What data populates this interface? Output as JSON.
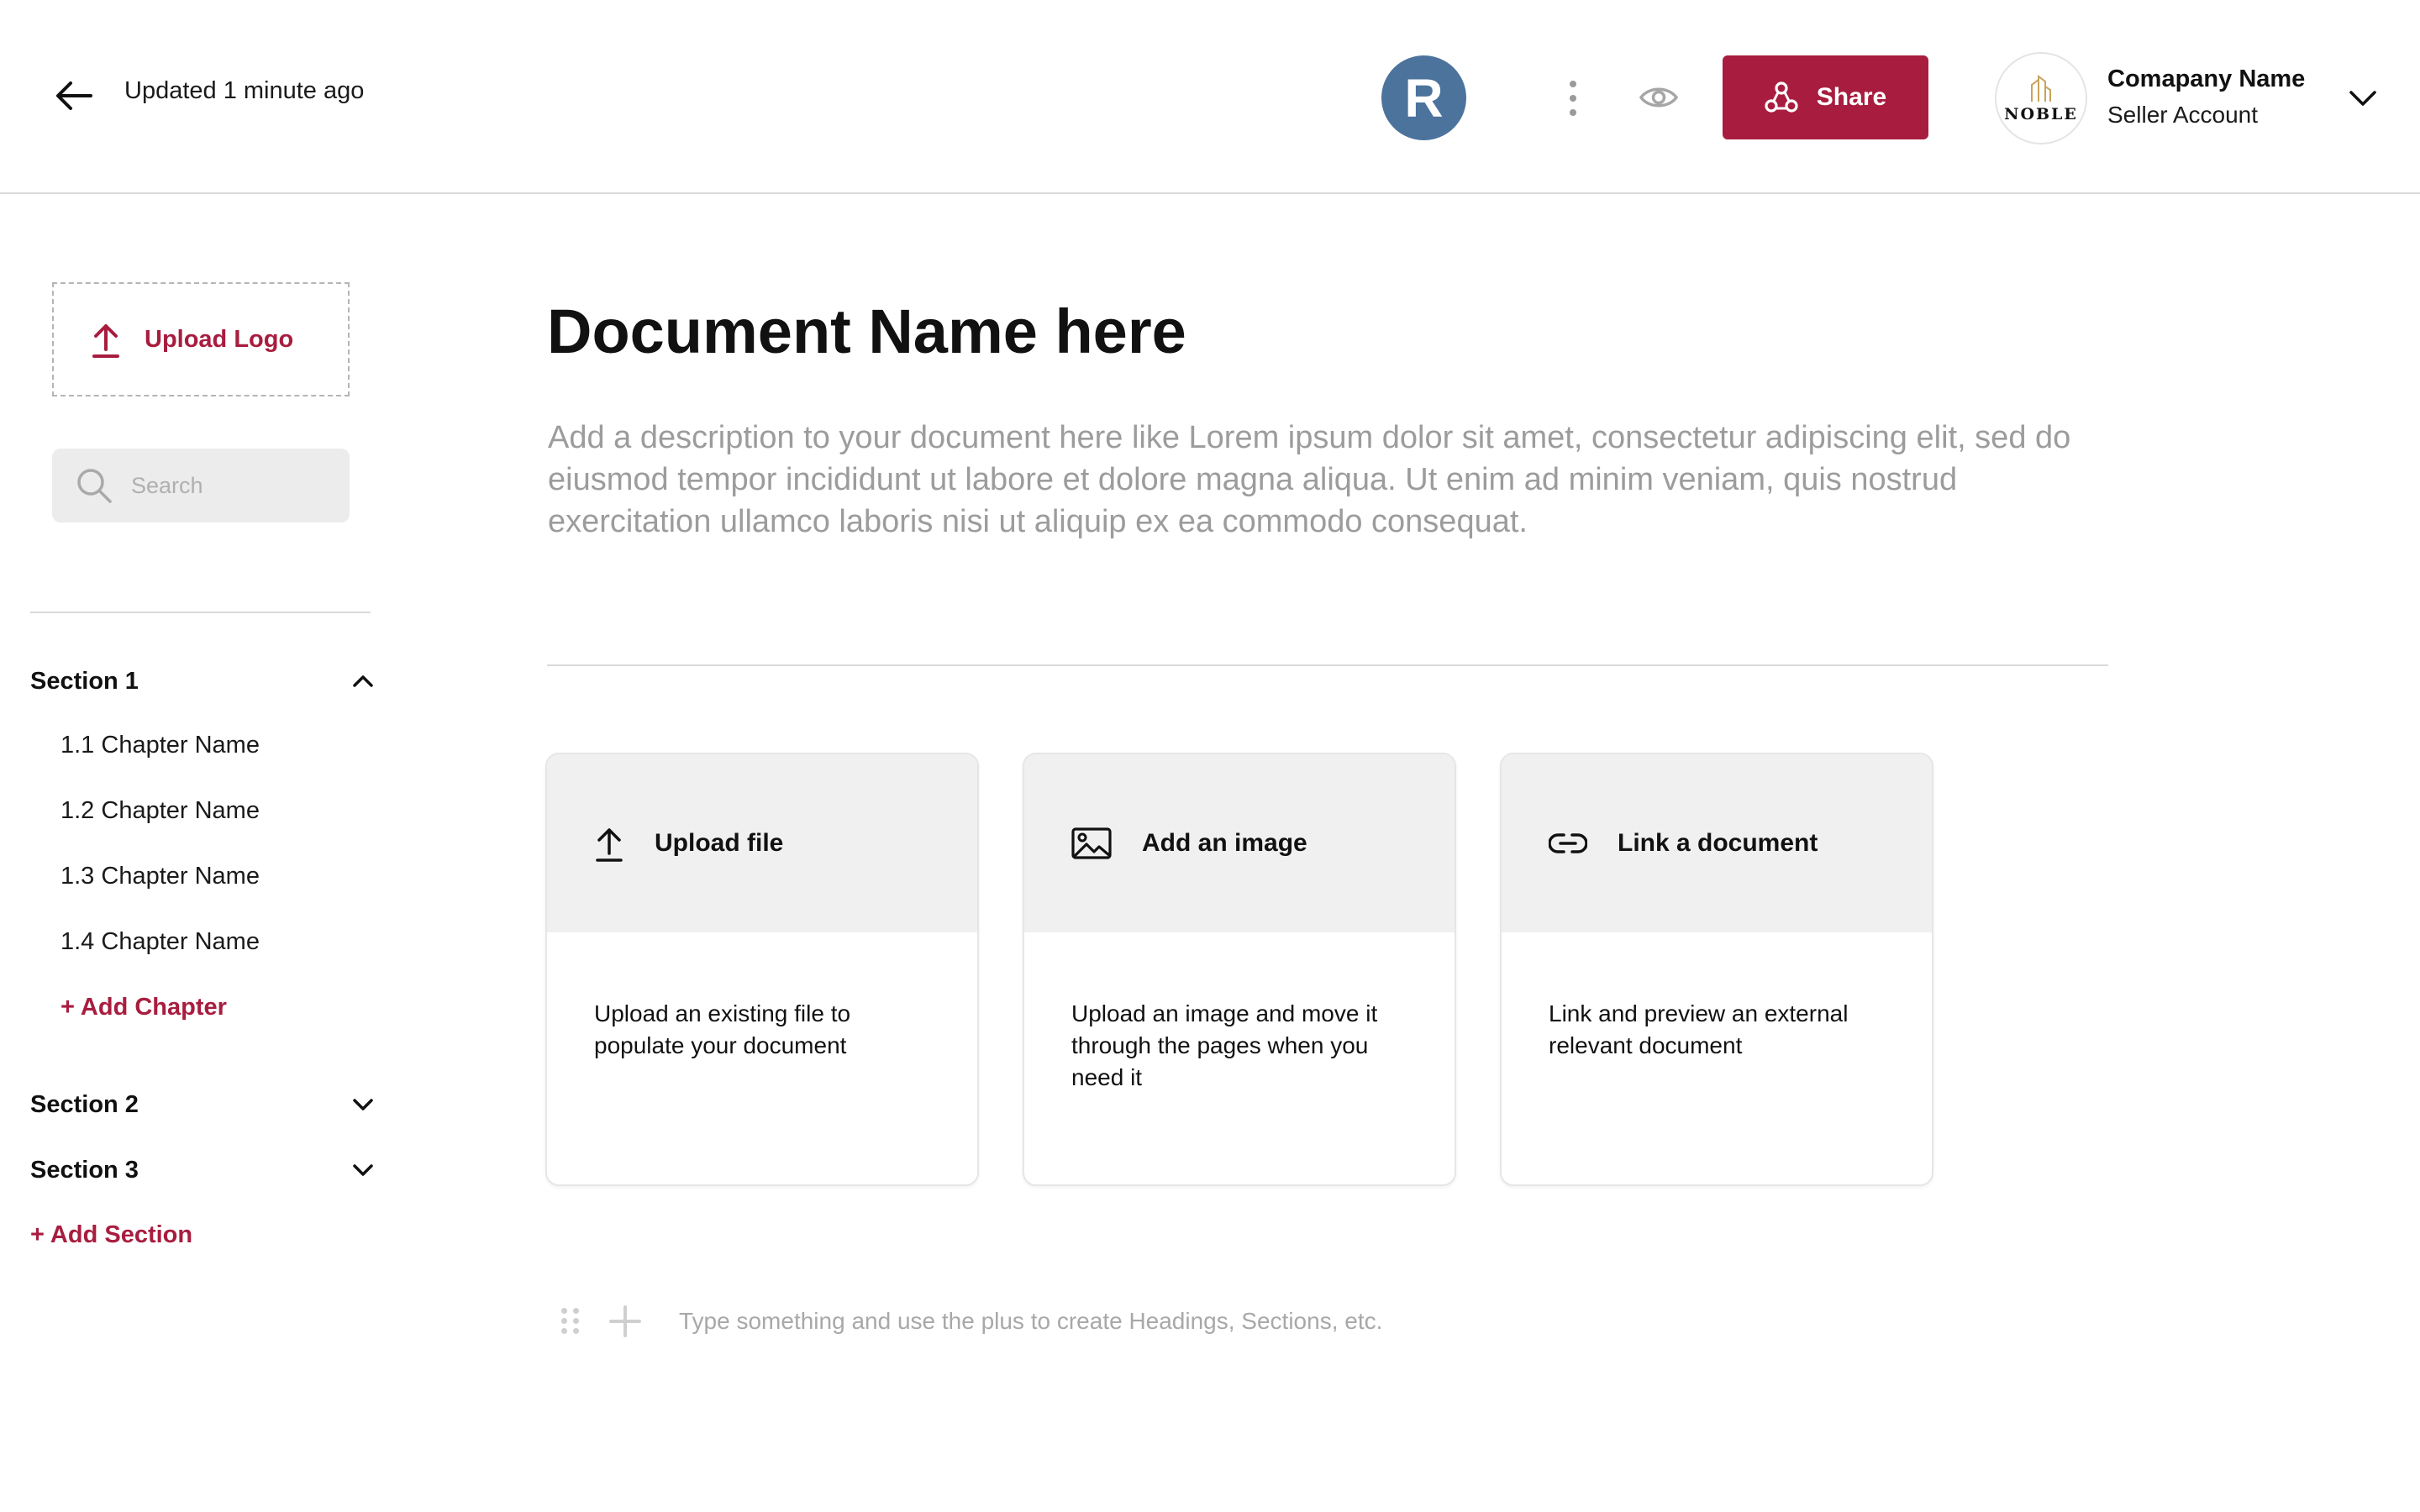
{
  "header": {
    "updated_text": "Updated 1 minute ago",
    "avatar_initial": "R",
    "share_label": "Share",
    "company_logo_text": "NOBLE",
    "company_name": "Comapany Name",
    "account_type": "Seller Account"
  },
  "sidebar": {
    "upload_logo_label": "Upload Logo",
    "search_placeholder": "Search",
    "sections": [
      {
        "label": "Section 1",
        "expanded": true,
        "chapters": [
          "1.1 Chapter Name",
          "1.2 Chapter Name",
          "1.3 Chapter Name",
          "1.4 Chapter Name"
        ],
        "add_chapter_label": "+ Add Chapter"
      },
      {
        "label": "Section 2",
        "expanded": false
      },
      {
        "label": "Section 3",
        "expanded": false
      }
    ],
    "add_section_label": "+ Add Section"
  },
  "document": {
    "title": "Document Name here",
    "description": "Add a description to your document here like Lorem ipsum dolor sit amet, consectetur adipiscing elit, sed do eiusmod tempor incididunt ut labore et dolore magna aliqua. Ut enim ad minim veniam, quis nostrud exercitation ullamco laboris nisi ut aliquip ex ea commodo consequat."
  },
  "cards": [
    {
      "icon": "upload-icon",
      "title": "Upload file",
      "description": "Upload an existing file to populate your document"
    },
    {
      "icon": "image-icon",
      "title": "Add an image",
      "description": "Upload an image and move it through the pages when you need it"
    },
    {
      "icon": "link-icon",
      "title": "Link a document",
      "description": "Link and preview an external relevant document"
    }
  ],
  "editor": {
    "placeholder": "Type something and use the plus to create Headings, Sections, etc."
  },
  "colors": {
    "accent": "#a81d3f",
    "avatar_bg": "#4b739c",
    "card_header_bg": "#f0f0f0",
    "muted_text": "#9c9c9c"
  }
}
